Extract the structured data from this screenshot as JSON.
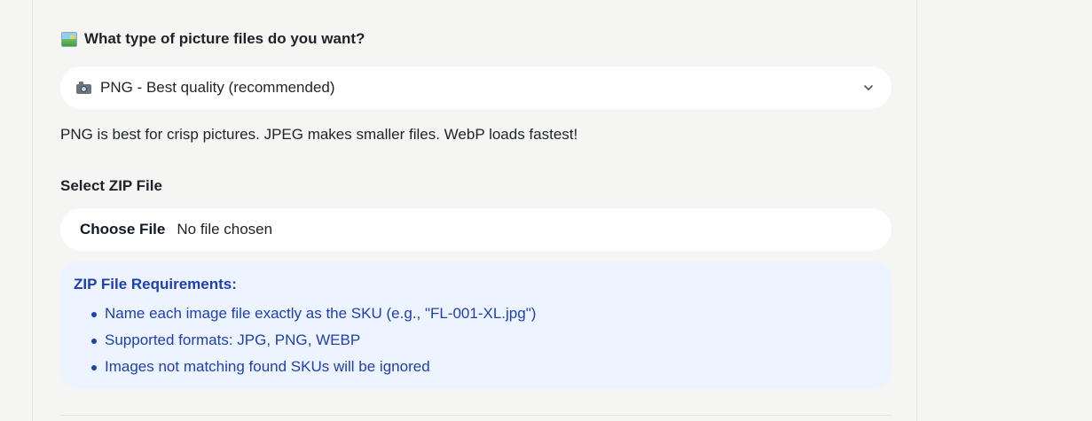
{
  "format_section": {
    "label": "What type of picture files do you want?",
    "icon": "picture-icon",
    "select": {
      "icon": "camera-icon",
      "selected_value": "PNG - Best quality (recommended)"
    },
    "hint": "PNG is best for crisp pictures. JPEG makes smaller files. WebP loads fastest!"
  },
  "zip_section": {
    "label": "Select ZIP File",
    "choose_button": "Choose File",
    "status": "No file chosen"
  },
  "requirements": {
    "title": "ZIP File Requirements:",
    "items": [
      "Name each image file exactly as the SKU (e.g., \"FL-001-XL.jpg\")",
      "Supported formats: JPG, PNG, WEBP",
      "Images not matching found SKUs will be ignored"
    ]
  },
  "colors": {
    "page_background": "#f5f5f4",
    "field_background": "#ffffff",
    "info_background": "#eef4ff",
    "info_text": "#1e40af"
  }
}
